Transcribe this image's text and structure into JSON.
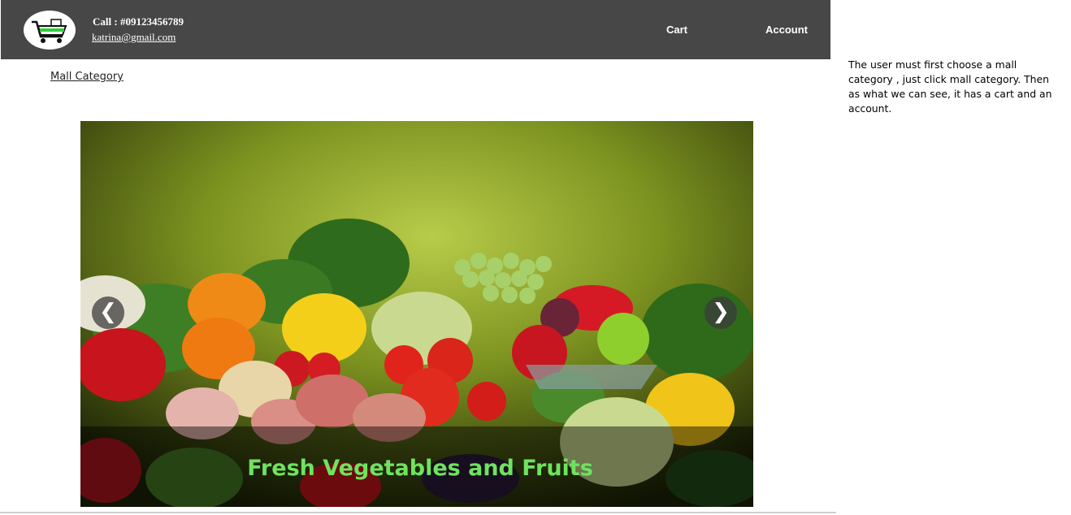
{
  "header": {
    "logo_icon": "cart-logo-icon",
    "call": "Call : #09123456789",
    "email": "katrina@gmail.com",
    "nav": {
      "cart": "Cart",
      "account": "Account"
    }
  },
  "mall_category_link": "Mall Category",
  "slider": {
    "caption": "Fresh Vegetables and Fruits",
    "prev_icon": "chevron-left-icon",
    "next_icon": "chevron-right-icon",
    "prev_glyph": "❮",
    "next_glyph": "❯"
  },
  "note": "The user must first choose a mall category , just click mall category. Then as what we can see, it has a cart and an account.",
  "colors": {
    "header_bg": "#474747",
    "caption_color": "#6fe35f"
  }
}
